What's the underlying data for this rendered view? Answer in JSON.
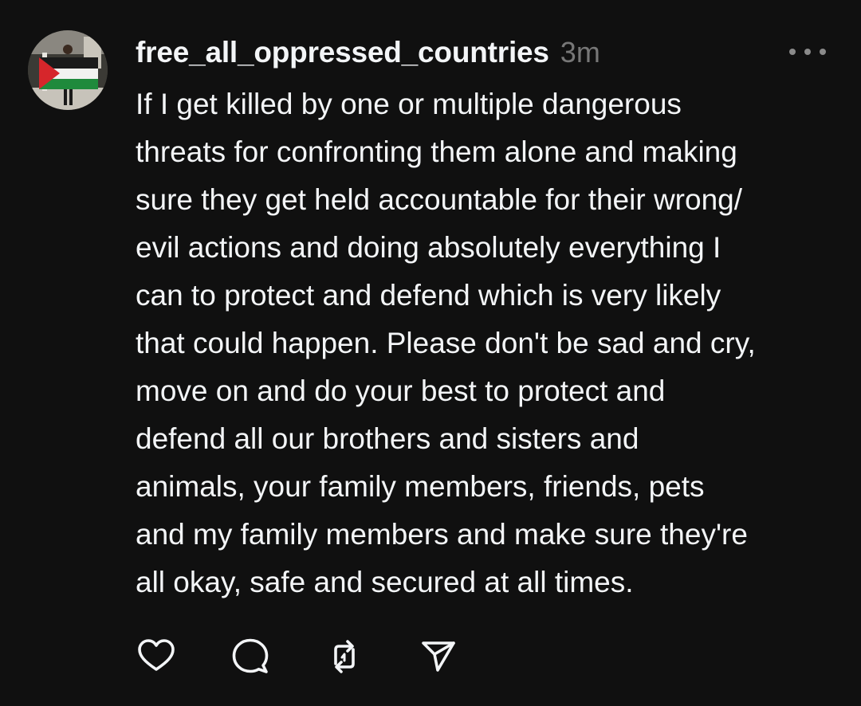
{
  "post": {
    "username": "free_all_oppressed_countries",
    "timestamp": "3m",
    "more_icon": "more-horizontal-icon",
    "body_lines": [
      "If I get killed by one or multiple dangerous",
      "threats for confronting them alone and making",
      "sure they get held accountable for their wrong/",
      "evil actions and doing absolutely everything I",
      "can to protect and defend which is very likely",
      "that could happen. Please don't be sad and cry,",
      "move on and do your best to protect and",
      "defend all our brothers and sisters and",
      "animals, your family members, friends, pets",
      "and my family members and make sure they're",
      "all okay, safe and secured at all times."
    ],
    "actions": [
      "heart-icon",
      "comment-icon",
      "repost-icon",
      "share-icon"
    ]
  },
  "colors": {
    "background": "#101010",
    "text_primary": "#f3f5f7",
    "text_secondary": "#777777",
    "icon": "#f3f5f7"
  }
}
